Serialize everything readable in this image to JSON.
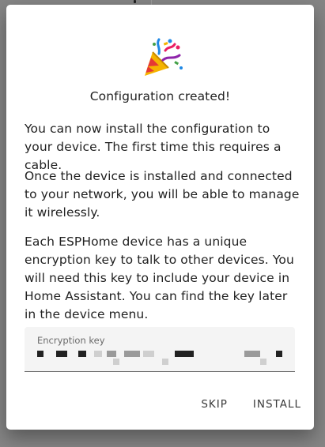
{
  "dialog": {
    "icon": "party-popper-icon",
    "title": "Configuration created!",
    "paragraphs": [
      "You can now install the configuration to your device. The first time this requires a cable.",
      "Once the device is installed and connected to your network, you will be able to manage it wirelessly.",
      "Each ESPHome device has a unique encryption key to talk to other devices. You will need this key to include your device in Home Assistant. You can find the key later in the device menu."
    ],
    "encryption_key": {
      "label": "Encryption key",
      "value_obscured": true
    },
    "actions": {
      "skip_label": "SKIP",
      "install_label": "INSTALL"
    }
  },
  "colors": {
    "backdrop": "#858585",
    "surface": "#ffffff",
    "text": "#212121",
    "field_bg": "#f4f4f4"
  }
}
